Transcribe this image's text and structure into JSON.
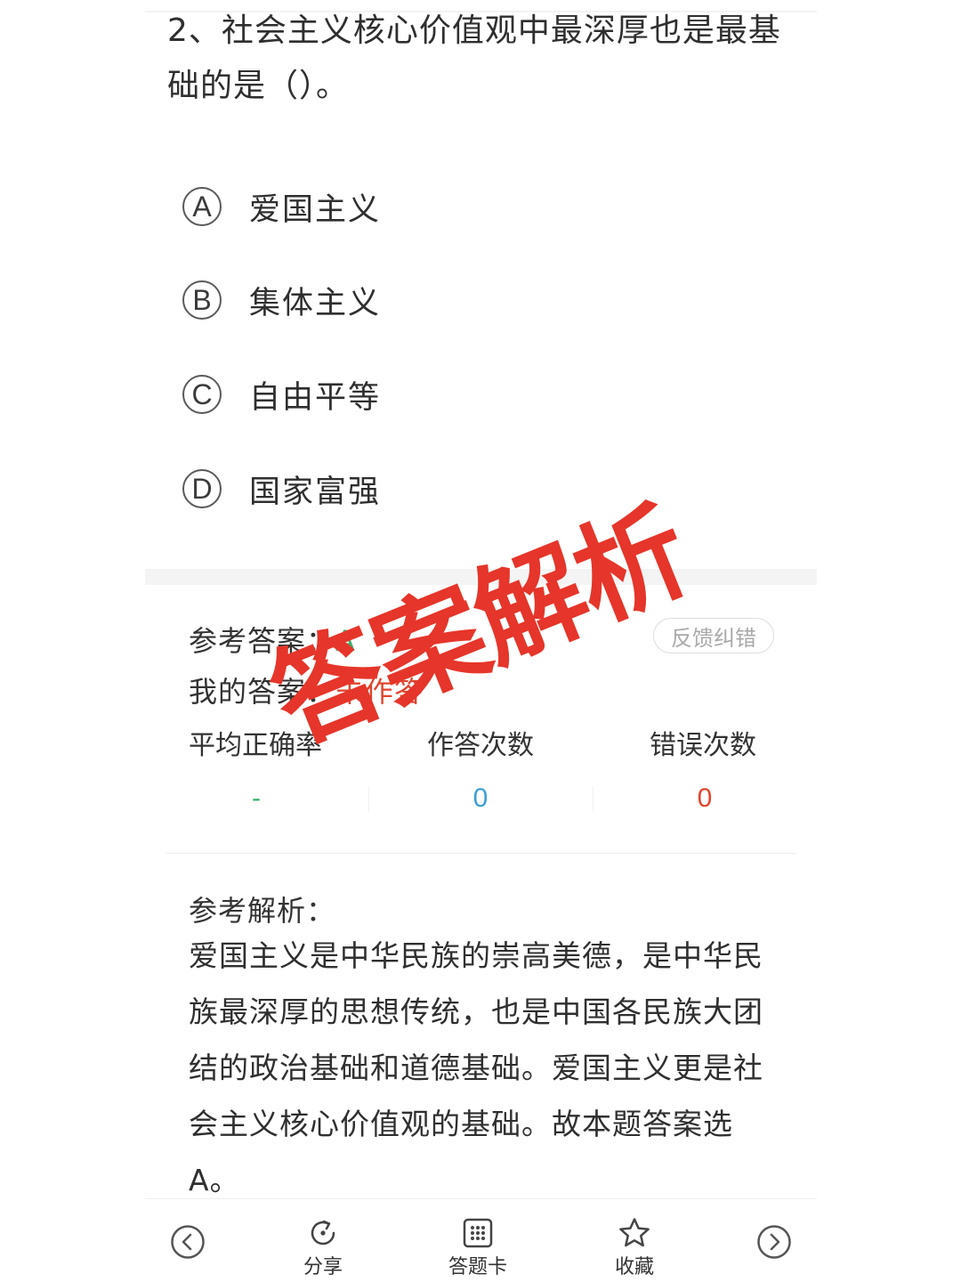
{
  "question": {
    "text": "2、社会主义核心价值观中最深厚也是最基础的是（）。"
  },
  "options": [
    {
      "letter": "A",
      "text": "爱国主义"
    },
    {
      "letter": "B",
      "text": "集体主义"
    },
    {
      "letter": "C",
      "text": "自由平等"
    },
    {
      "letter": "D",
      "text": "国家富强"
    }
  ],
  "answer_section": {
    "reference_label": "参考答案：",
    "reference_value": "A",
    "mine_label": "我的答案：",
    "mine_value": "未作答",
    "feedback_label": "反馈纠错"
  },
  "stats": {
    "avg_label": "平均正确率",
    "avg_value": "-",
    "done_label": "作答次数",
    "done_value": "0",
    "wrong_label": "错误次数",
    "wrong_value": "0"
  },
  "analysis": {
    "title": "参考解析：",
    "body": "爱国主义是中华民族的崇高美德，是中华民族最深厚的思想传统，也是中国各民族大团结的政治基础和道德基础。爱国主义更是社会主义核心价值观的基础。故本题答案选A。"
  },
  "stamp_text": "答案解析",
  "colors": {
    "correct": "#3cb26b",
    "wrong": "#e0452f",
    "count": "#3a9fd6",
    "stamp": "#e6352a"
  },
  "bottom_nav": {
    "prev_icon": "chevron-left-icon",
    "share_label": "分享",
    "answer_card_label": "答题卡",
    "favorite_label": "收藏",
    "next_icon": "chevron-right-icon"
  }
}
